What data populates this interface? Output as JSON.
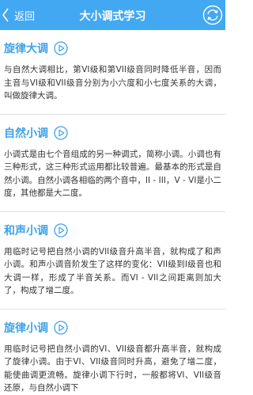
{
  "header": {
    "back_label": "返回",
    "title": "大小调式学习"
  },
  "sections": [
    {
      "title": "旋律大调",
      "body": "与自然大调相比，第VI级和第VII级音同时降低半音，因而主音与VI级和VII级音分别为小六度和小七度关系的大调，叫做旋律大调。"
    },
    {
      "title": "自然小调",
      "body": "小调式是由七个音组成的另一种调式，简称小调。小调也有三种形式，这三种形式运用都比较普遍。最基本的形式是自然小调。自然小调各相临的两个音中，II - III，V - VI是小二度，其他都是大二度。"
    },
    {
      "title": "和声小调",
      "body": "用临时记号把自然小调的VII级音升高半音，就构成了和声小调。和声小调音阶发生了这样的变化：VII级到I级音也和大调一样，形成了半音关系。而VI - VII之间距离则加大了，构成了增二度。"
    },
    {
      "title": "旋律小调",
      "body": "用临时记号把自然小调的VI、VII级音都升高半音，就构成了旋律小调。由于VI、VII级音同时升高，避免了增二度，能使曲调更流畅。旋律小调下行时，一般都将VI、VII级音还原，与自然小调下"
    }
  ]
}
